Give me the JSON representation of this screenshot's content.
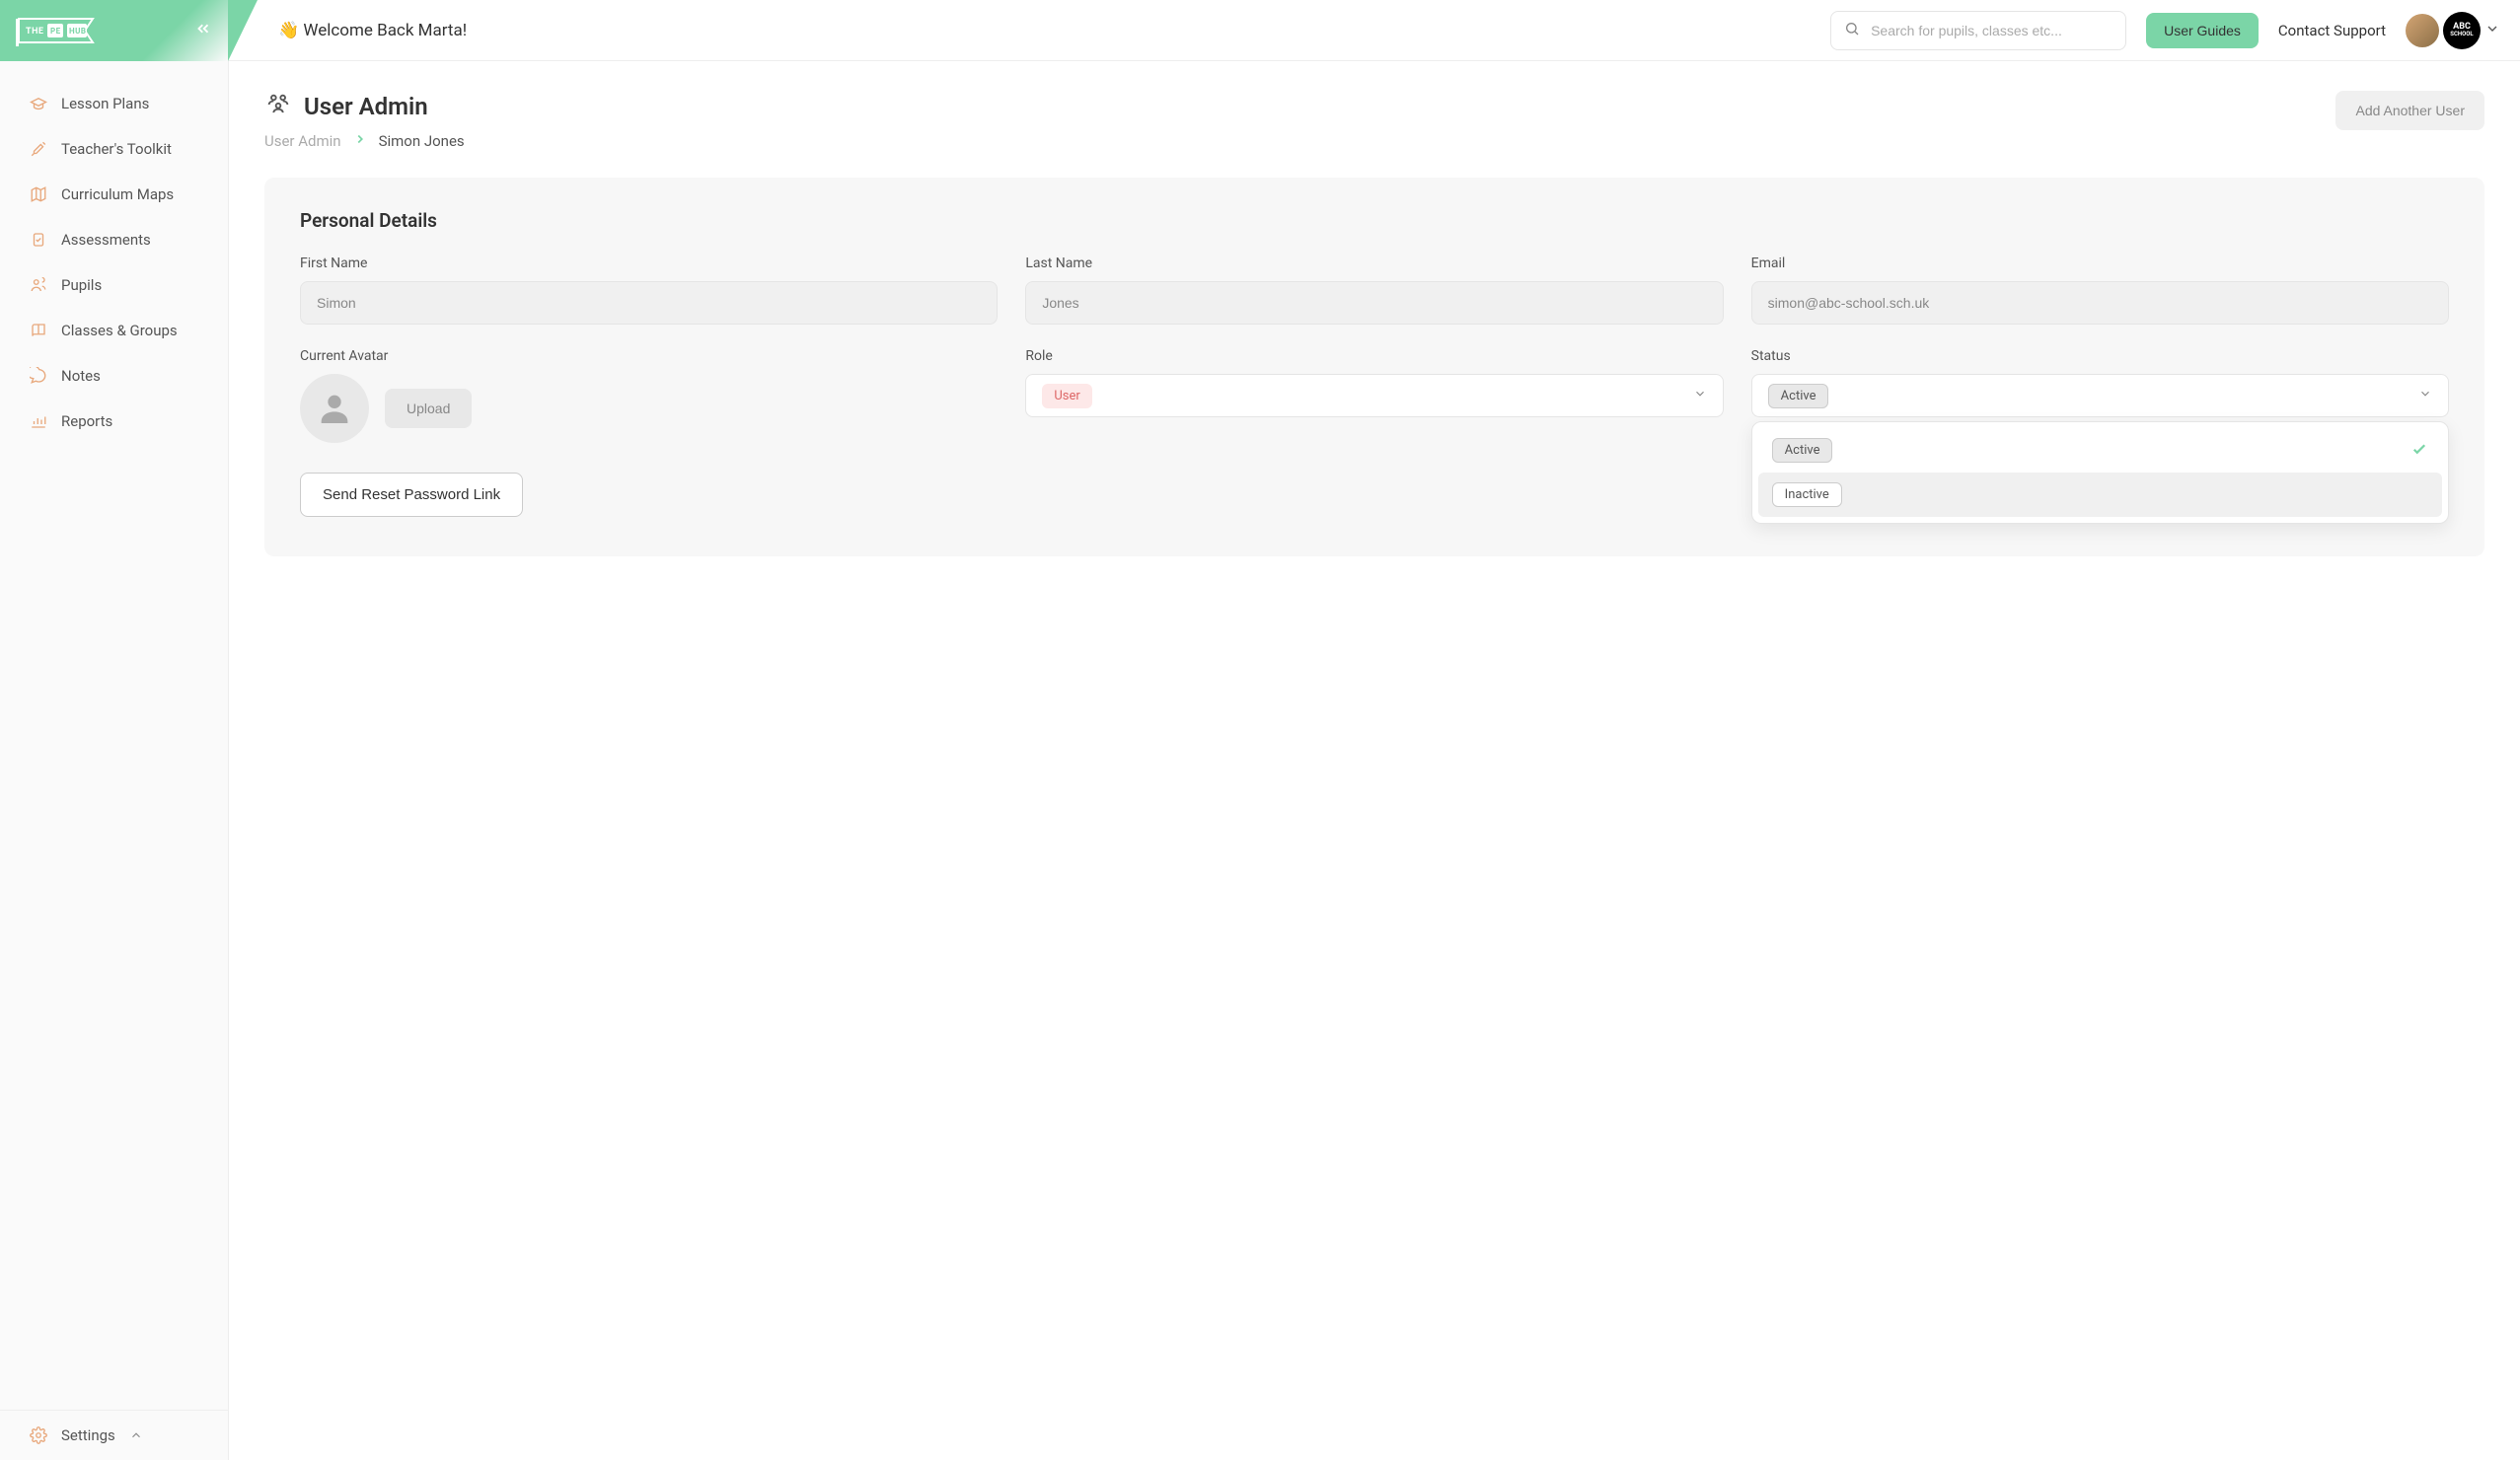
{
  "brand": {
    "name": "THE PE HUB"
  },
  "header": {
    "welcome_emoji": "👋",
    "welcome_text": "Welcome Back Marta!",
    "search_placeholder": "Search for pupils, classes etc...",
    "user_guides_label": "User Guides",
    "contact_label": "Contact Support",
    "school_badge": "ABC SCHOOL"
  },
  "sidebar": {
    "items": [
      {
        "label": "Lesson Plans",
        "icon": "grad-cap-icon"
      },
      {
        "label": "Teacher's Toolkit",
        "icon": "pencil-ruler-icon"
      },
      {
        "label": "Curriculum Maps",
        "icon": "map-icon"
      },
      {
        "label": "Assessments",
        "icon": "clipboard-check-icon"
      },
      {
        "label": "Pupils",
        "icon": "users-icon"
      },
      {
        "label": "Classes & Groups",
        "icon": "book-icon"
      },
      {
        "label": "Notes",
        "icon": "chat-icon"
      },
      {
        "label": "Reports",
        "icon": "chart-icon"
      }
    ],
    "settings_label": "Settings"
  },
  "page": {
    "title": "User Admin",
    "breadcrumb_root": "User Admin",
    "breadcrumb_current": "Simon Jones",
    "add_user_label": "Add Another User"
  },
  "card": {
    "title": "Personal Details",
    "fields": {
      "first_name_label": "First Name",
      "first_name_value": "Simon",
      "last_name_label": "Last Name",
      "last_name_value": "Jones",
      "email_label": "Email",
      "email_value": "simon@abc-school.sch.uk",
      "avatar_label": "Current Avatar",
      "upload_label": "Upload",
      "role_label": "Role",
      "role_value": "User",
      "status_label": "Status",
      "status_value": "Active"
    },
    "status_options": [
      {
        "label": "Active",
        "selected": true
      },
      {
        "label": "Inactive",
        "selected": false
      }
    ],
    "reset_label": "Send Reset Password Link"
  }
}
